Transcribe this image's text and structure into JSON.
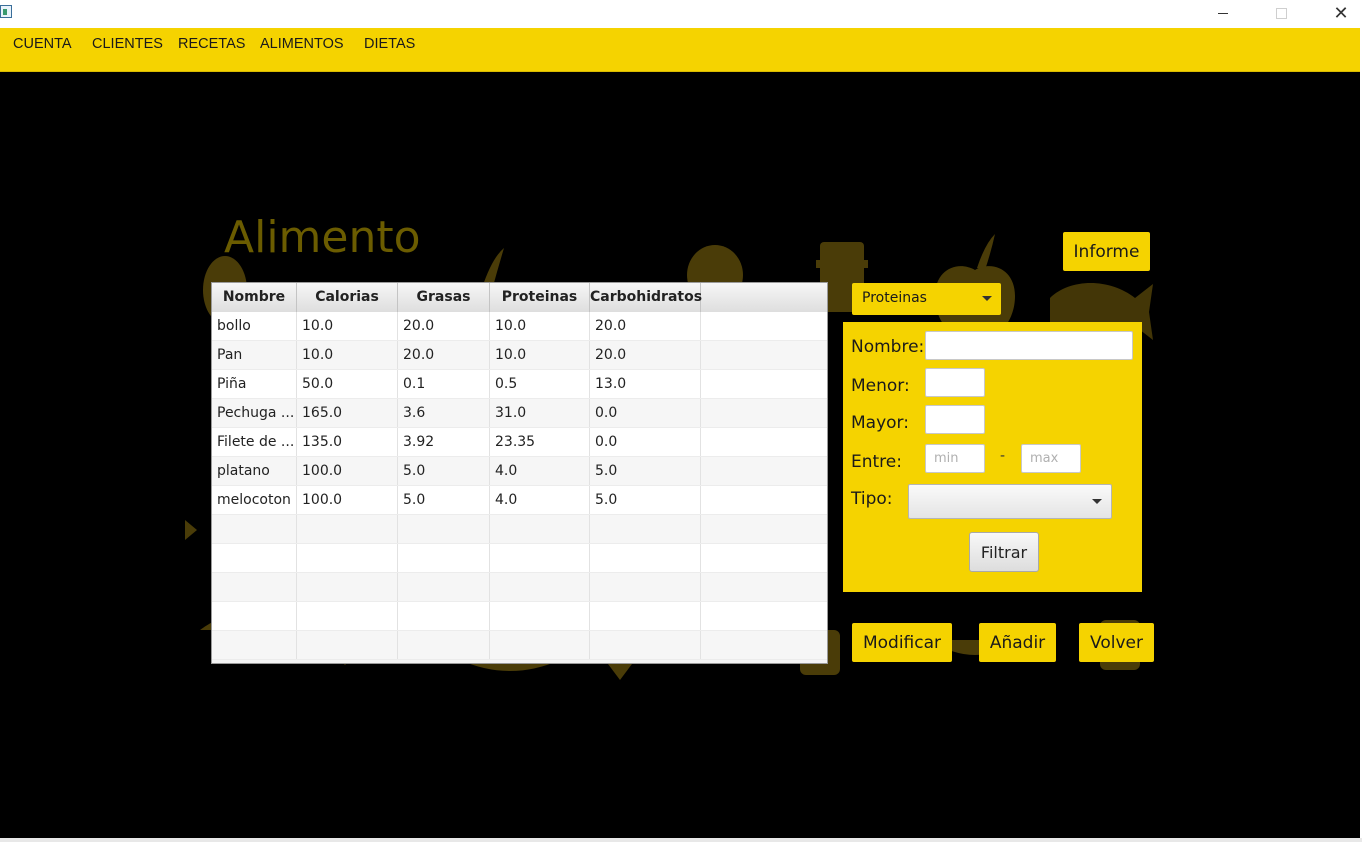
{
  "menu": [
    "CUENTA",
    "CLIENTES",
    "RECETAS",
    "ALIMENTOS",
    "DIETAS"
  ],
  "page_title": "Alimento",
  "buttons": {
    "informe": "Informe",
    "modificar": "Modificar",
    "anadir": "Añadir",
    "volver": "Volver",
    "filtrar": "Filtrar"
  },
  "sort_combo": {
    "selected": "Proteinas"
  },
  "table": {
    "columns": [
      "Nombre",
      "Calorias",
      "Grasas",
      "Proteinas",
      "Carbohidratos"
    ],
    "rows": [
      [
        "bollo",
        "10.0",
        "20.0",
        "10.0",
        "20.0"
      ],
      [
        "Pan",
        "10.0",
        "20.0",
        "10.0",
        "20.0"
      ],
      [
        "Piña",
        "50.0",
        "0.1",
        "0.5",
        "13.0"
      ],
      [
        "Pechuga ...",
        "165.0",
        "3.6",
        "31.0",
        "0.0"
      ],
      [
        "Filete de ...",
        "135.0",
        "3.92",
        "23.35",
        "0.0"
      ],
      [
        "platano",
        "100.0",
        "5.0",
        "4.0",
        "5.0"
      ],
      [
        "melocoton",
        "100.0",
        "5.0",
        "4.0",
        "5.0"
      ]
    ]
  },
  "filter": {
    "nombre_label": "Nombre:",
    "menor_label": "Menor:",
    "mayor_label": "Mayor:",
    "entre_label": "Entre:",
    "min_placeholder": "min",
    "dash": "-",
    "max_placeholder": "max",
    "tipo_label": "Tipo:"
  },
  "colors": {
    "accent": "#f5d300",
    "background": "#000000",
    "title": "#6b5c00"
  }
}
